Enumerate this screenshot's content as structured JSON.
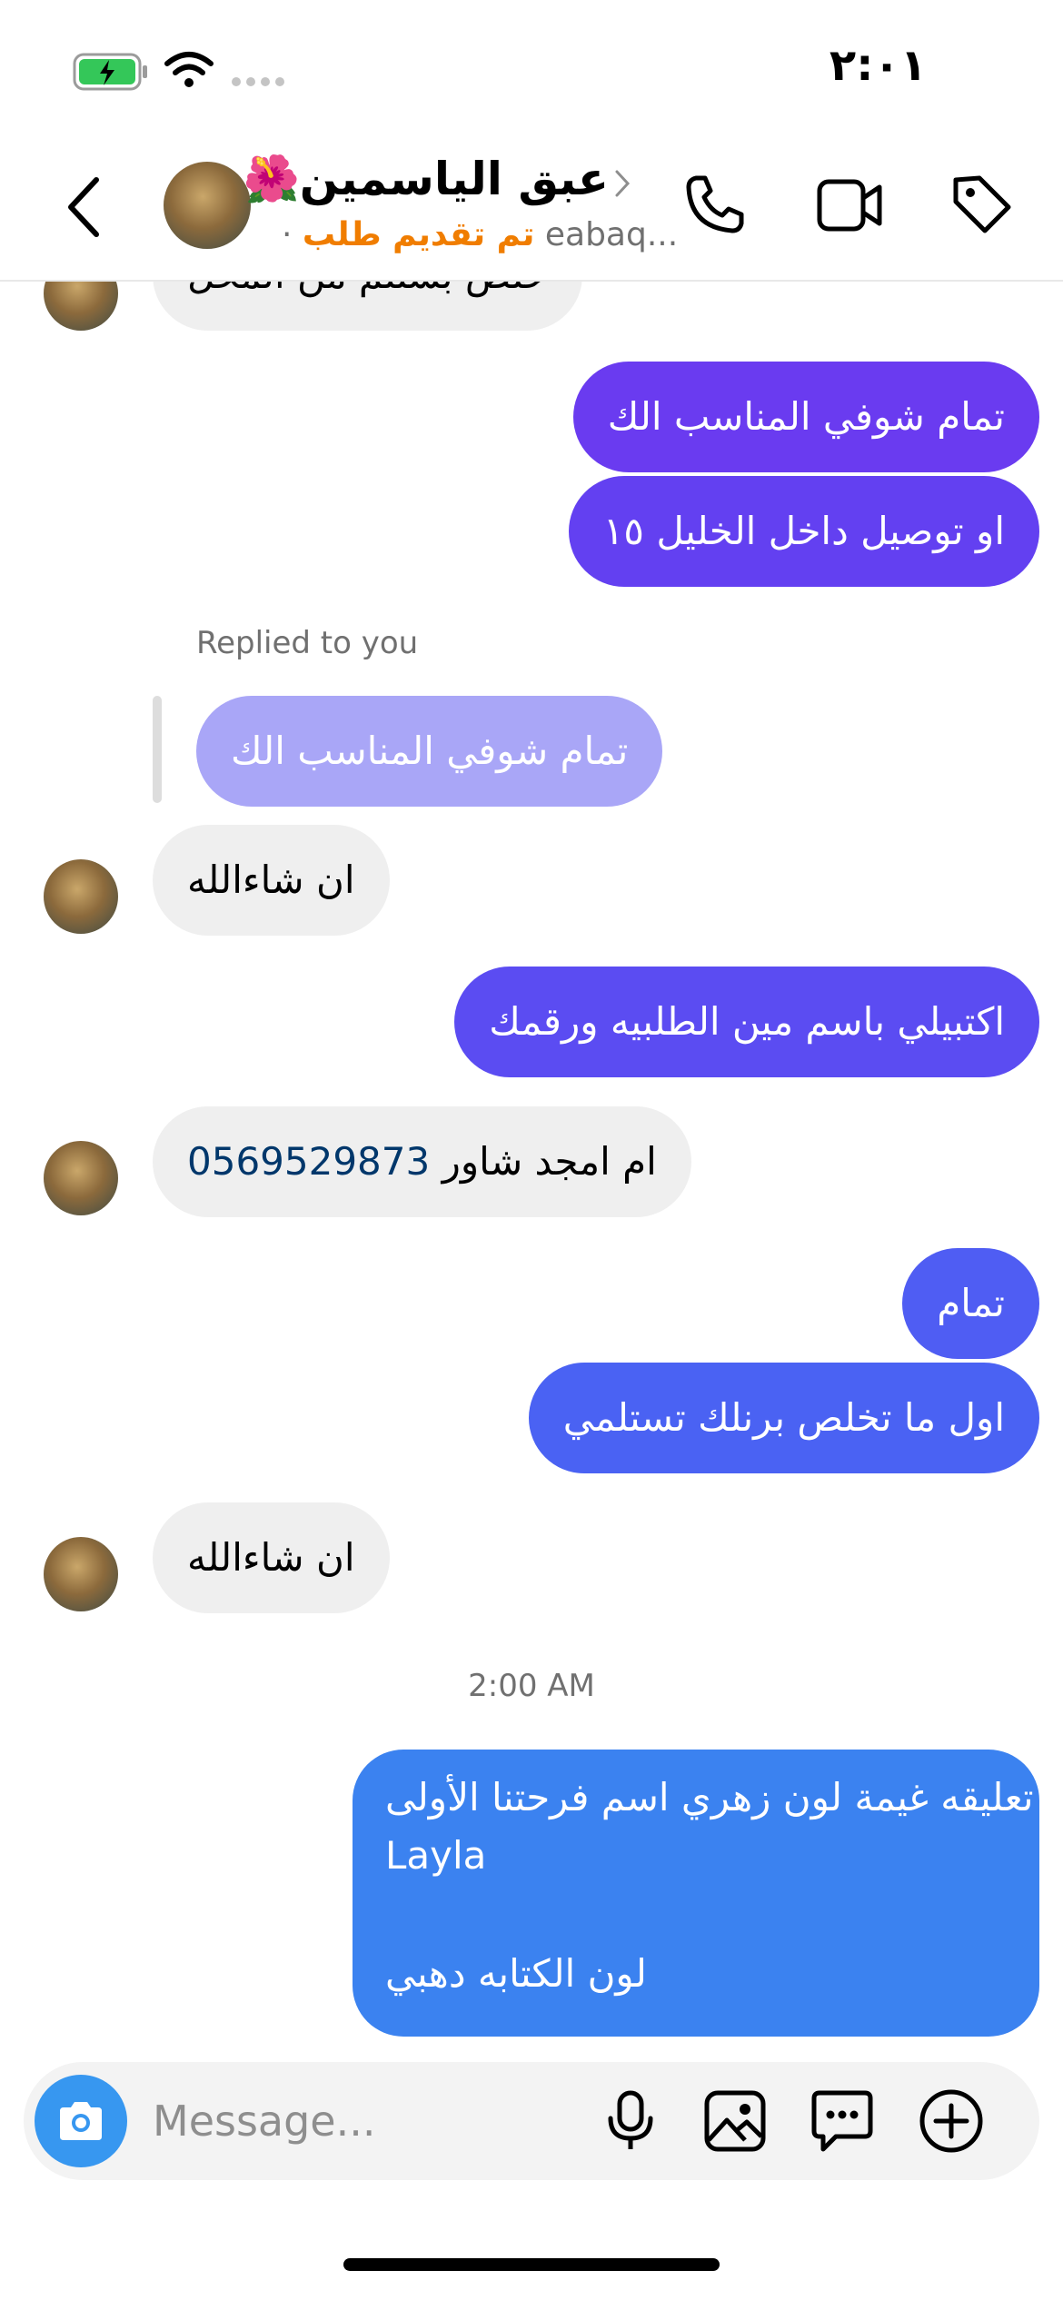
{
  "status_bar": {
    "time": "٢:٠١"
  },
  "header": {
    "contact_name": "عبق الياسمين🌺",
    "username": "eabaq...",
    "status": "تم تقديم طلب",
    "dot": "·"
  },
  "messages": {
    "m0": "خلص بستلم من المحل",
    "m1": "تمام شوفي المناسب الك",
    "m2": "او توصيل داخل الخليل ١٥",
    "replied_label": "Replied to you",
    "reply_quote": "تمام شوفي المناسب الك",
    "m3": "ان شاءالله",
    "m4": "اكتبيلي باسم مين الطلبيه ورقمك",
    "m5_text": "ام امجد شاور",
    "m5_phone": "0569529873",
    "m6": "تمام",
    "m7": "اول ما تخلص برنلك تستلمي",
    "m8": "ان شاءالله",
    "timestamp": "2:00 AM",
    "m9_line1": "تعليقه غيمة لون زهري اسم فرحتنا الأولى",
    "m9_line2": "Layla",
    "m9_line3": "لون الكتابه دهبي"
  },
  "composer": {
    "placeholder": "Message..."
  },
  "colors": {
    "purple": "#6a3bf0",
    "violet": "#5b4cf2",
    "indigo": "#4f5df3",
    "blue": "#3b82f0",
    "reply_quote_bg": "#a9a6f7",
    "incoming_bg": "#efefef",
    "accent_orange": "#f07d00",
    "phone_link": "#00376b"
  },
  "icons": [
    "battery-charging-icon",
    "wifi-icon",
    "signal-dots-icon",
    "back-chevron-icon",
    "phone-icon",
    "video-icon",
    "tag-icon",
    "camera-icon",
    "microphone-icon",
    "gallery-icon",
    "sticker-icon",
    "add-icon"
  ]
}
